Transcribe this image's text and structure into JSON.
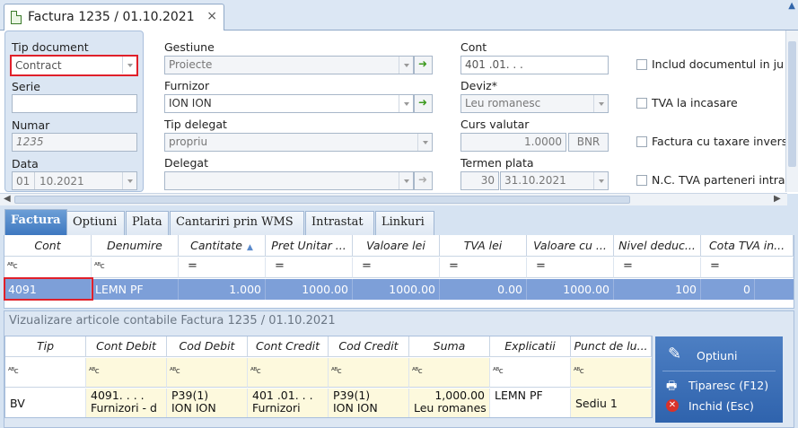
{
  "window": {
    "tab_title": "Factura 1235 / 01.10.2021",
    "close": "×"
  },
  "form": {
    "tip_document": {
      "label": "Tip document",
      "value": "Contract"
    },
    "serie": {
      "label": "Serie",
      "value": ""
    },
    "numar": {
      "label": "Numar",
      "value": "1235"
    },
    "data": {
      "label": "Data",
      "day": "01",
      "rest": "10.2021"
    },
    "gestiune": {
      "label": "Gestiune",
      "value": "Proiecte"
    },
    "furnizor": {
      "label": "Furnizor",
      "value": "ION ION"
    },
    "tip_delegat": {
      "label": "Tip delegat",
      "value": "propriu"
    },
    "delegat": {
      "label": "Delegat",
      "value": ""
    },
    "cont": {
      "label": "Cont",
      "value": "401 .01.  .  ."
    },
    "deviz": {
      "label": "Deviz*",
      "value": "Leu romanesc"
    },
    "curs_valutar": {
      "label": "Curs valutar",
      "value": "1.0000",
      "source": "BNR"
    },
    "termen_plata": {
      "label": "Termen plata",
      "days": "30",
      "date": "31.10.2021"
    },
    "checkboxes": [
      "Includ documentul in ju",
      "TVA la incasare",
      "Factura cu taxare invers",
      "N.C. TVA parteneri intra"
    ]
  },
  "tabs": [
    "Factura",
    "Optiuni",
    "Plata",
    "Cantariri prin WMS",
    "Intrastat",
    "Linkuri"
  ],
  "grid": {
    "headers": [
      "Cont",
      "Denumire",
      "Cantitate",
      "Pret Unitar ...",
      "Valoare lei",
      "TVA lei",
      "Valoare cu ...",
      "Nivel deduc...",
      "Cota TVA in..."
    ],
    "filter_text": "ᴬᴮc",
    "filter_eq": "=",
    "rows": [
      [
        "4091",
        "LEMN PF",
        "1.000",
        "1000.00",
        "1000.00",
        "0.00",
        "1000.00",
        "100",
        "0"
      ]
    ]
  },
  "lower": {
    "title": "Vizualizare articole contabile Factura 1235 / 01.10.2021",
    "headers": [
      "Tip",
      "Cont Debit",
      "Cod Debit",
      "Cont Credit",
      "Cod Credit",
      "Suma",
      "Explicatii",
      "Punct de lu..."
    ],
    "row": {
      "tip": "BV",
      "cont_debit_1": "4091.  .  .  .",
      "cont_debit_2": "Furnizori - d",
      "cod_debit_1": "P39(1)",
      "cod_debit_2": "ION ION",
      "cont_credit_1": "401 .01.  .  .",
      "cont_credit_2": "Furnizori",
      "cod_credit_1": "P39(1)",
      "cod_credit_2": "ION ION",
      "suma_1": "1,000.00",
      "suma_2": "Leu romanes",
      "explicatii": "LEMN PF",
      "punct": "Sediu 1"
    }
  },
  "side": {
    "optiuni": "Optiuni",
    "tiparesc": "Tiparesc (F12)",
    "inchid": "Inchid (Esc)"
  }
}
